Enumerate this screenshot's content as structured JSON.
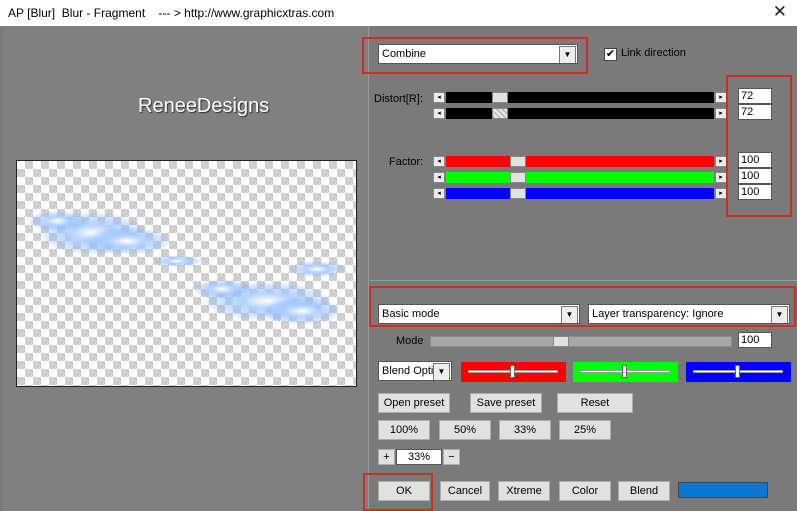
{
  "window": {
    "title": "AP [Blur]  Blur - Fragment    --- > http://www.graphicxtras.com"
  },
  "preview": {
    "logo_text": "ReneeDesigns"
  },
  "mode_select": {
    "value": "Combine"
  },
  "link_direction": {
    "label": "Link direction",
    "checked": true
  },
  "distort": {
    "label": "Distort[R]:",
    "values": [
      "72",
      "72"
    ]
  },
  "factor": {
    "label": "Factor:",
    "values": [
      "100",
      "100",
      "100"
    ],
    "colors": [
      "#ff0000",
      "#00ff00",
      "#0000ff"
    ]
  },
  "basic_mode_select": {
    "value": "Basic mode"
  },
  "layer_transparency_select": {
    "value": "Layer transparency: Ignore"
  },
  "mode_slider": {
    "label": "Mode",
    "value": "100"
  },
  "blend_options": {
    "select_value": "Blend Optio",
    "swatches": [
      "#ff0000",
      "#00ff00",
      "#0000ff"
    ]
  },
  "buttons": {
    "open_preset": "Open preset",
    "save_preset": "Save preset",
    "reset": "Reset",
    "zoom_100": "100%",
    "zoom_50": "50%",
    "zoom_33": "33%",
    "zoom_25": "25%",
    "plus": "+",
    "minus": "−",
    "ok": "OK",
    "cancel": "Cancel",
    "xtreme": "Xtreme",
    "color": "Color",
    "blend": "Blend"
  },
  "zoom": {
    "value": "33%"
  },
  "blend_color": "#0a78d0",
  "accent_red": "#c8301f"
}
